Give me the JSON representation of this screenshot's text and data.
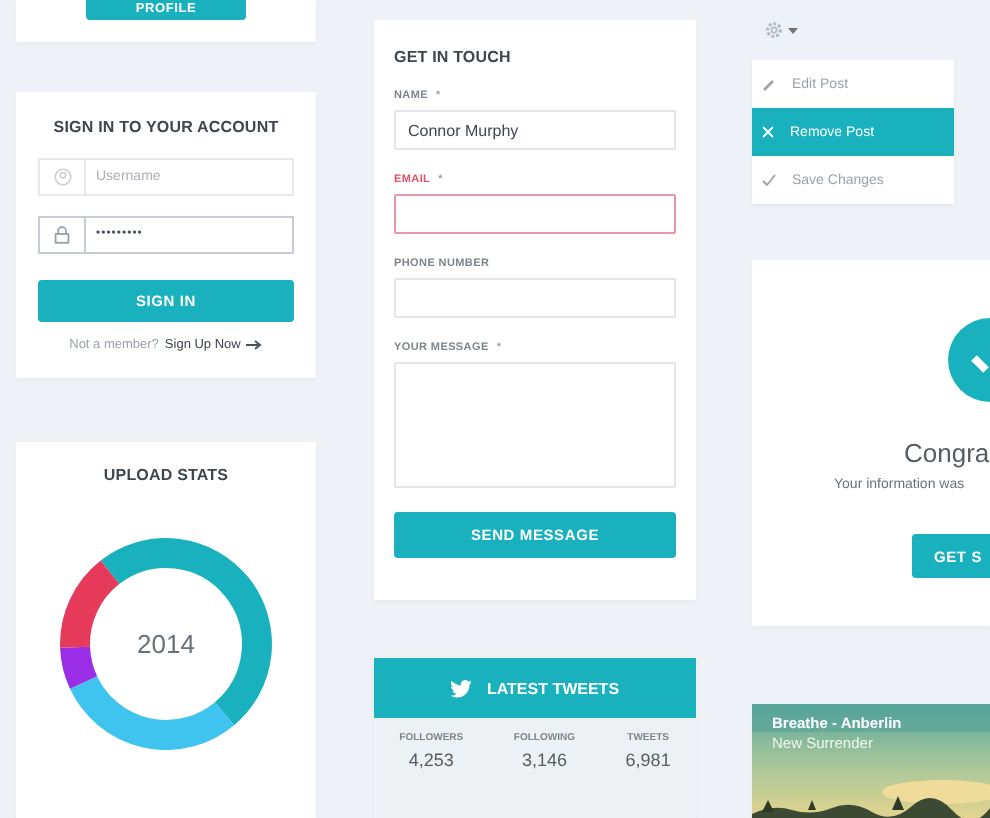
{
  "profile_card": {
    "button": "PROFILE"
  },
  "sign_in": {
    "title": "SIGN IN TO YOUR ACCOUNT",
    "username_placeholder": "Username",
    "password_value": "•••••••••",
    "button": "SIGN IN",
    "prompt": "Not a member?",
    "link": "Sign Up Now"
  },
  "upload_stats": {
    "title": "UPLOAD STATS",
    "center_label": "2014"
  },
  "contact": {
    "title": "GET IN TOUCH",
    "fields": [
      {
        "kind": "input",
        "label": "NAME",
        "marker": "*",
        "error": false,
        "value": "Connor Murphy"
      },
      {
        "kind": "input",
        "label": "EMAIL",
        "marker": "*",
        "error": true
      },
      {
        "kind": "input",
        "label": "PHONE NUMBER",
        "error": false
      },
      {
        "kind": "textarea",
        "label": "YOUR MESSAGE",
        "marker": "*",
        "error": false
      }
    ],
    "button": "SEND MESSAGE"
  },
  "tweets": {
    "title": "LATEST TWEETS",
    "stats": [
      {
        "label": "FOLLOWERS",
        "value": "4,253"
      },
      {
        "label": "FOLLOWING",
        "value": "3,146"
      },
      {
        "label": "TWEETS",
        "value": "6,981"
      }
    ]
  },
  "menu": {
    "items": [
      {
        "label": "Edit Post",
        "selected": false
      },
      {
        "label": "Remove Post",
        "selected": true
      },
      {
        "label": "Save Changes",
        "selected": false
      }
    ]
  },
  "congrats": {
    "title": "Congra",
    "message": "Your information was",
    "button": "GET S"
  },
  "music": {
    "title": "Breathe - Anberlin",
    "subtitle": "New Surrender"
  }
}
